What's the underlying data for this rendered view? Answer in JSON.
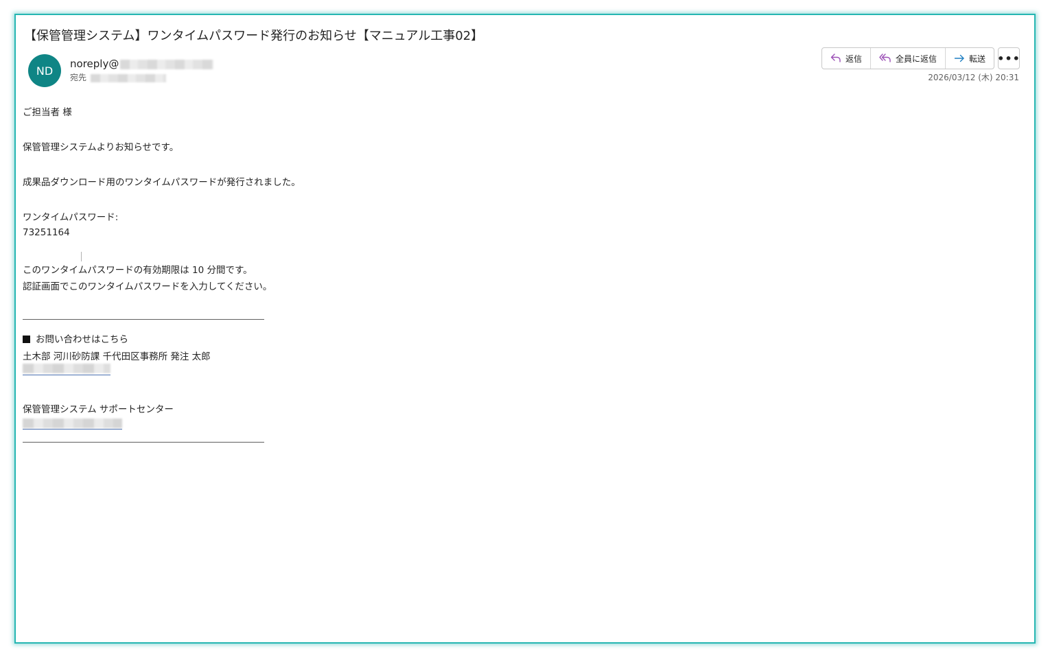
{
  "email": {
    "subject": "【保管管理システム】ワンタイムパスワード発行のお知らせ【マニュアル工事02】",
    "avatar_initials": "ND",
    "avatar_color": "#0f8585",
    "sender": "noreply@",
    "to_label": "宛先",
    "date": "2026/03/12 (木) 20:31"
  },
  "toolbar": {
    "reply_label": "返信",
    "reply_all_label": "全員に返信",
    "forward_label": "転送",
    "more_label": "•••",
    "reply_icon": "reply-icon",
    "reply_all_icon": "reply-all-icon",
    "forward_icon": "forward-icon"
  },
  "body": {
    "greeting": "ご担当者 様",
    "intro": "保管管理システムよりお知らせです。",
    "notice": "成果品ダウンロード用のワンタイムパスワードが発行されました。",
    "otp_label": "ワンタイムパスワード:",
    "otp_value": "73251164",
    "validity": "このワンタイムパスワードの有効期限は 10 分間です。",
    "instruction": "認証画面でこのワンタイムパスワードを入力してください。",
    "contact_heading": "お問い合わせはこちら",
    "contact_person": "土木部 河川砂防課 千代田区事務所 発注 太郎",
    "support_center": "保管管理システム サポートセンター"
  },
  "colors": {
    "frame_border": "#25b6b2",
    "reply_icon": "#9b4fb6",
    "forward_icon": "#1f7fc2",
    "link": "#4a6fb0"
  }
}
